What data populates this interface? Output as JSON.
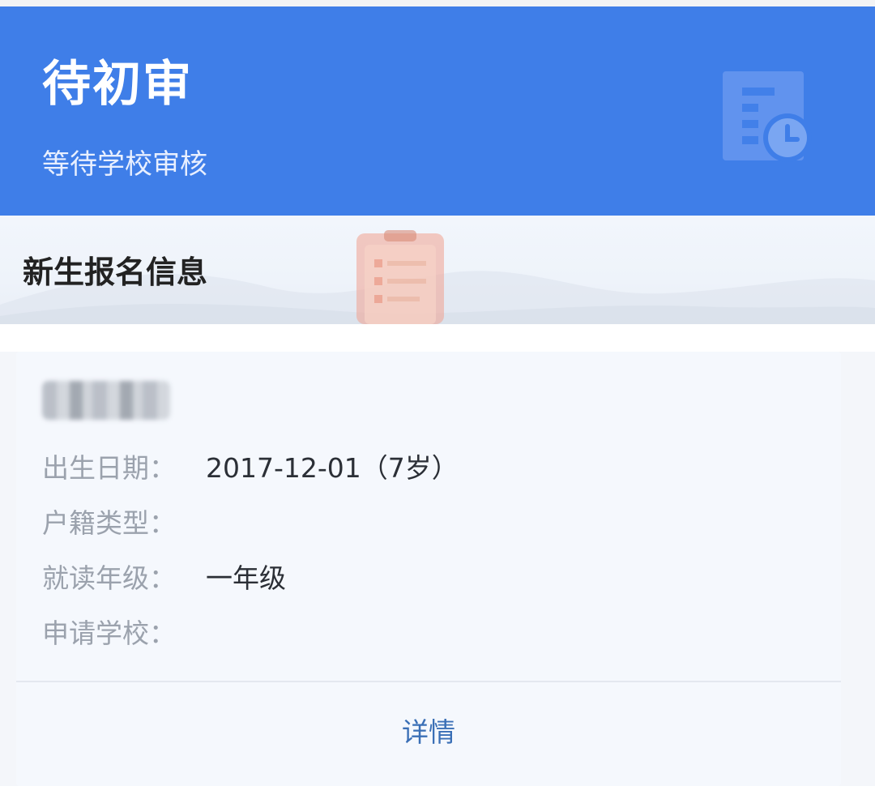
{
  "status": {
    "title": "待初审",
    "subtitle": "等待学校审核",
    "header_color": "#3f7ee8",
    "icon": "document-clock-icon"
  },
  "section": {
    "title": "新生报名信息",
    "illustration": "clipboard-illustration"
  },
  "card": {
    "fields": [
      {
        "label": "出生日期：",
        "value": "2017-12-01（7岁）"
      },
      {
        "label": "户籍类型：",
        "value": ""
      },
      {
        "label": "就读年级：",
        "value": "一年级"
      },
      {
        "label": "申请学校：",
        "value": ""
      }
    ],
    "details_label": "详情",
    "link_color": "#3a6fb6"
  }
}
